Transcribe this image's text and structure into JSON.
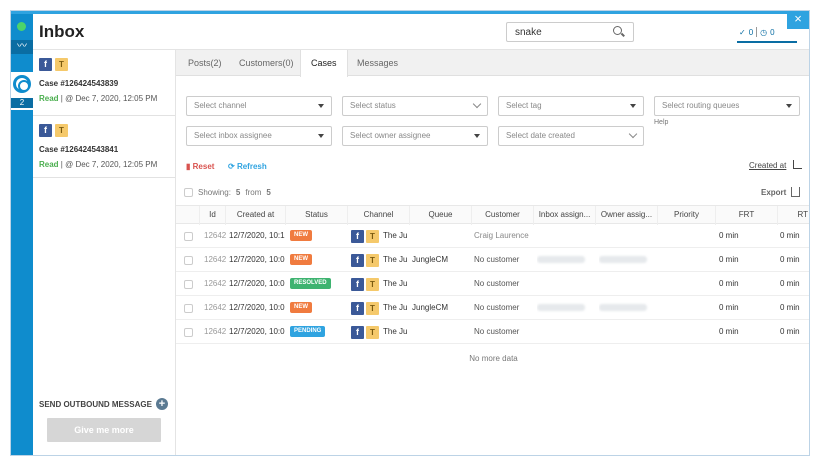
{
  "header": {
    "title": "Inbox",
    "search_value": "snake",
    "counter_done": "0",
    "counter_pending": "0",
    "close_glyph": "×"
  },
  "rail": {
    "badge": "2",
    "wave_glyph": "〰"
  },
  "cases": [
    {
      "title": "Case #126424543839",
      "status": "Read",
      "meta": "| @ Dec 7, 2020, 12:05 PM"
    },
    {
      "title": "Case #126424543841",
      "status": "Read",
      "meta": "| @ Dec 7, 2020, 12:05 PM"
    }
  ],
  "sidebar": {
    "outbound_label": "SEND OUTBOUND MESSAGE",
    "give_me_more": "Give me more"
  },
  "tabs": [
    "Posts(2)",
    "Customers(0)",
    "Cases",
    "Messages"
  ],
  "filters": {
    "channel": "Select channel",
    "status": "Select status",
    "tag": "Select tag",
    "routing": "Select routing queues",
    "inbox_assignee": "Select inbox assignee",
    "owner_assignee": "Select owner assignee",
    "date_created": "Select date created",
    "help": "Help"
  },
  "actions": {
    "reset": "Reset",
    "refresh": "Refresh",
    "sort_label": "Created at",
    "showing_prefix": "Showing:",
    "showing_count": "5",
    "showing_from": "from",
    "showing_total": "5",
    "export": "Export"
  },
  "columns": [
    "Id",
    "Created at",
    "Status",
    "Channel",
    "Queue",
    "Customer",
    "Inbox assign...",
    "Owner assig...",
    "Priority",
    "FRT",
    "RT"
  ],
  "rows": [
    {
      "id": "12642",
      "created": "12/7/2020, 10:1",
      "status": "NEW",
      "channel": "The Ju",
      "queue": "",
      "customer": "Craig Laurence",
      "frt": "0 min",
      "rt": "0 min"
    },
    {
      "id": "12642",
      "created": "12/7/2020, 10:0",
      "status": "NEW",
      "channel": "The Ju",
      "queue": "JungleCM",
      "customer": "No customer",
      "frt": "0 min",
      "rt": "0 min"
    },
    {
      "id": "12642",
      "created": "12/7/2020, 10:0",
      "status": "RESOLVED",
      "channel": "The Ju",
      "queue": "",
      "customer": "No customer",
      "frt": "0 min",
      "rt": "0 min"
    },
    {
      "id": "12642",
      "created": "12/7/2020, 10:0",
      "status": "NEW",
      "channel": "The Ju",
      "queue": "JungleCM",
      "customer": "No customer",
      "frt": "0 min",
      "rt": "0 min"
    },
    {
      "id": "12642",
      "created": "12/7/2020, 10:0",
      "status": "PENDING",
      "channel": "The Ju",
      "queue": "",
      "customer": "No customer",
      "frt": "0 min",
      "rt": "0 min"
    }
  ],
  "no_more": "No more data",
  "colors": {
    "accent": "#0f8ccd",
    "new": "#f07b3f",
    "resolved": "#3eb370",
    "pending": "#2fa3e0",
    "read": "#4caf50"
  },
  "icons": {
    "facebook": "f",
    "tiktok": "T"
  }
}
